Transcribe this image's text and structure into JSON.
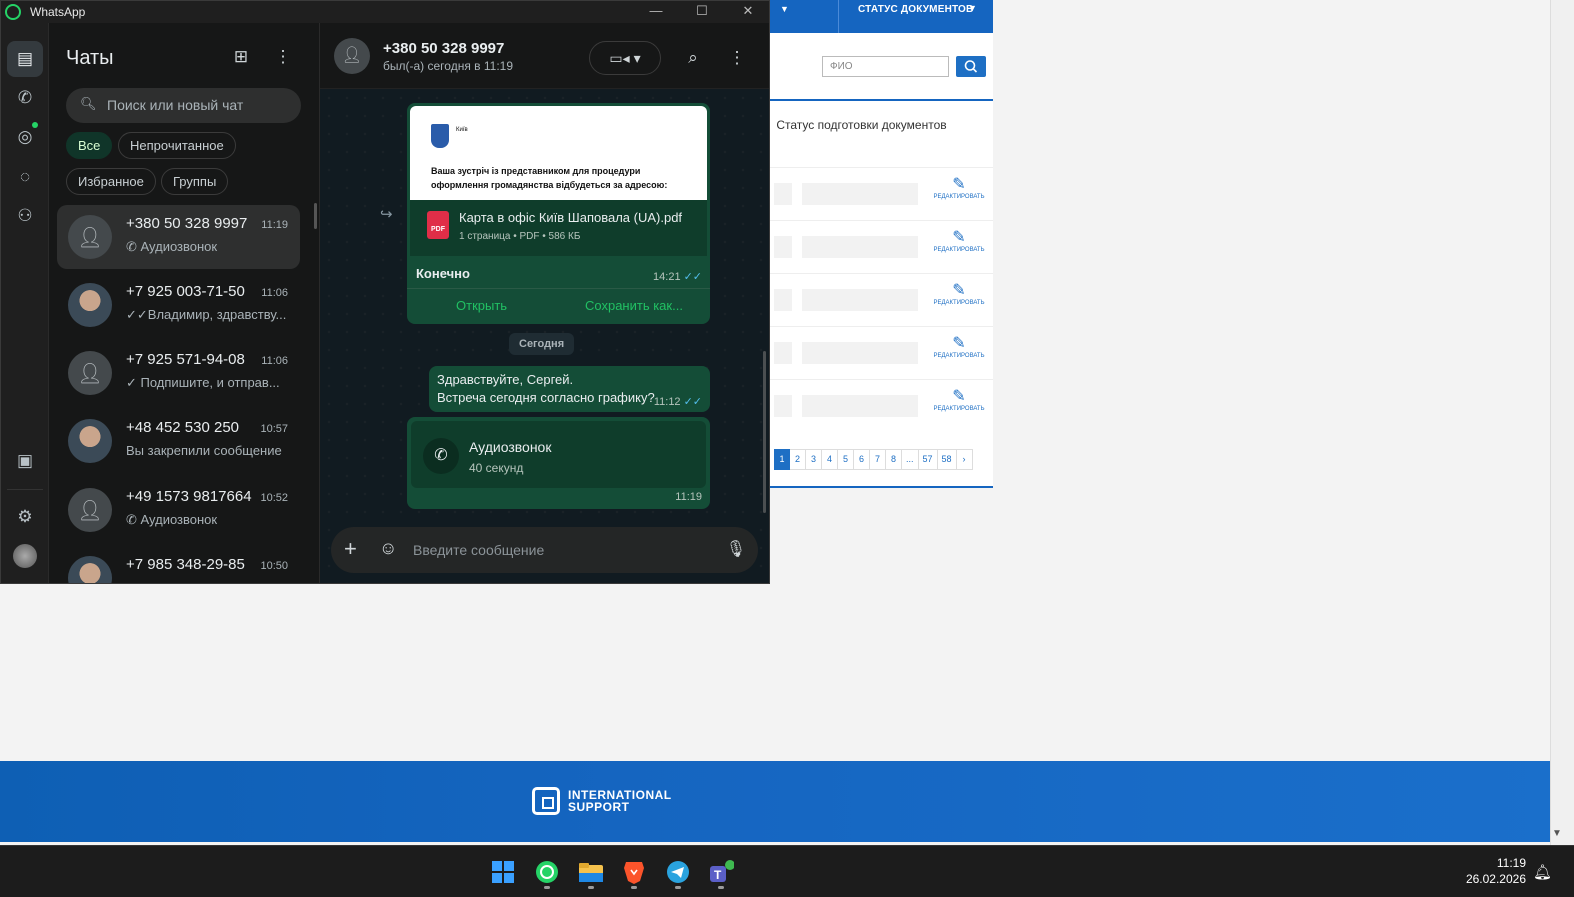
{
  "background_page": {
    "top_status_label": "СТАТУС ДОКУМЕНТОВ",
    "fio_placeholder": "ФИО",
    "column_header": "Статус подготовки документов",
    "edit_label": "редактировать",
    "pagination": [
      "1",
      "2",
      "3",
      "4",
      "5",
      "6",
      "7",
      "8",
      "...",
      "57",
      "58",
      "›"
    ],
    "footer_logo_line1": "INTERNATIONAL",
    "footer_logo_line2": "SUPPORT"
  },
  "whatsapp": {
    "window_title": "WhatsApp",
    "list_title": "Чаты",
    "search_placeholder": "Поиск или новый чат",
    "filters": [
      "Все",
      "Непрочитанное",
      "Избранное",
      "Группы"
    ],
    "chats": [
      {
        "name": "+380 50 328 9997",
        "time": "11:19",
        "preview": "Аудиозвонок",
        "icon": "phone-icon"
      },
      {
        "name": "+7 925 003-71-50",
        "time": "11:06",
        "preview": "Владимир, здравству...",
        "icon": "double-check-icon"
      },
      {
        "name": "+7 925 571-94-08",
        "time": "11:06",
        "preview": "Подпишите, и отправ...",
        "icon": "check-icon"
      },
      {
        "name": "+48 452 530 250",
        "time": "10:57",
        "preview": "Вы закрепили сообщение",
        "icon": ""
      },
      {
        "name": "+49 1573 9817664",
        "time": "10:52",
        "preview": "Аудиозвонок",
        "icon": "phone-icon"
      },
      {
        "name": "+7 985 348-29-85",
        "time": "10:50",
        "preview": "",
        "icon": ""
      }
    ],
    "chat": {
      "contact_name": "+380 50 328 9997",
      "contact_status": "был(-а) сегодня в 11:19",
      "document": {
        "preview_city": "Київ",
        "preview_text": "Ваша зустріч із представником для процедури оформлення громадянства відбудеться за адресою:",
        "file_name": "Карта в офіс Київ Шаповала (UA).pdf",
        "file_meta": "1 страница • PDF • 586 КБ",
        "file_type": "PDF",
        "caption": "Конечно",
        "time": "14:21",
        "open_label": "Открыть",
        "save_label": "Сохранить как..."
      },
      "date_separator": "Сегодня",
      "text_message": {
        "line1": "Здравствуйте, Сергей.",
        "line2": "Встреча сегодня согласно графику?",
        "time": "11:12"
      },
      "call_message": {
        "title": "Аудиозвонок",
        "duration": "40 секунд",
        "time": "11:19"
      },
      "composer_placeholder": "Введите сообщение"
    }
  },
  "taskbar": {
    "time": "11:19",
    "date": "26.02.2026",
    "apps": [
      "windows-start-icon",
      "whatsapp-icon",
      "file-explorer-icon",
      "brave-icon",
      "telegram-icon",
      "teams-icon"
    ]
  },
  "colors": {
    "wa_accent": "#21c063",
    "bubble_out": "#144d37",
    "site_blue": "#1565c0"
  }
}
